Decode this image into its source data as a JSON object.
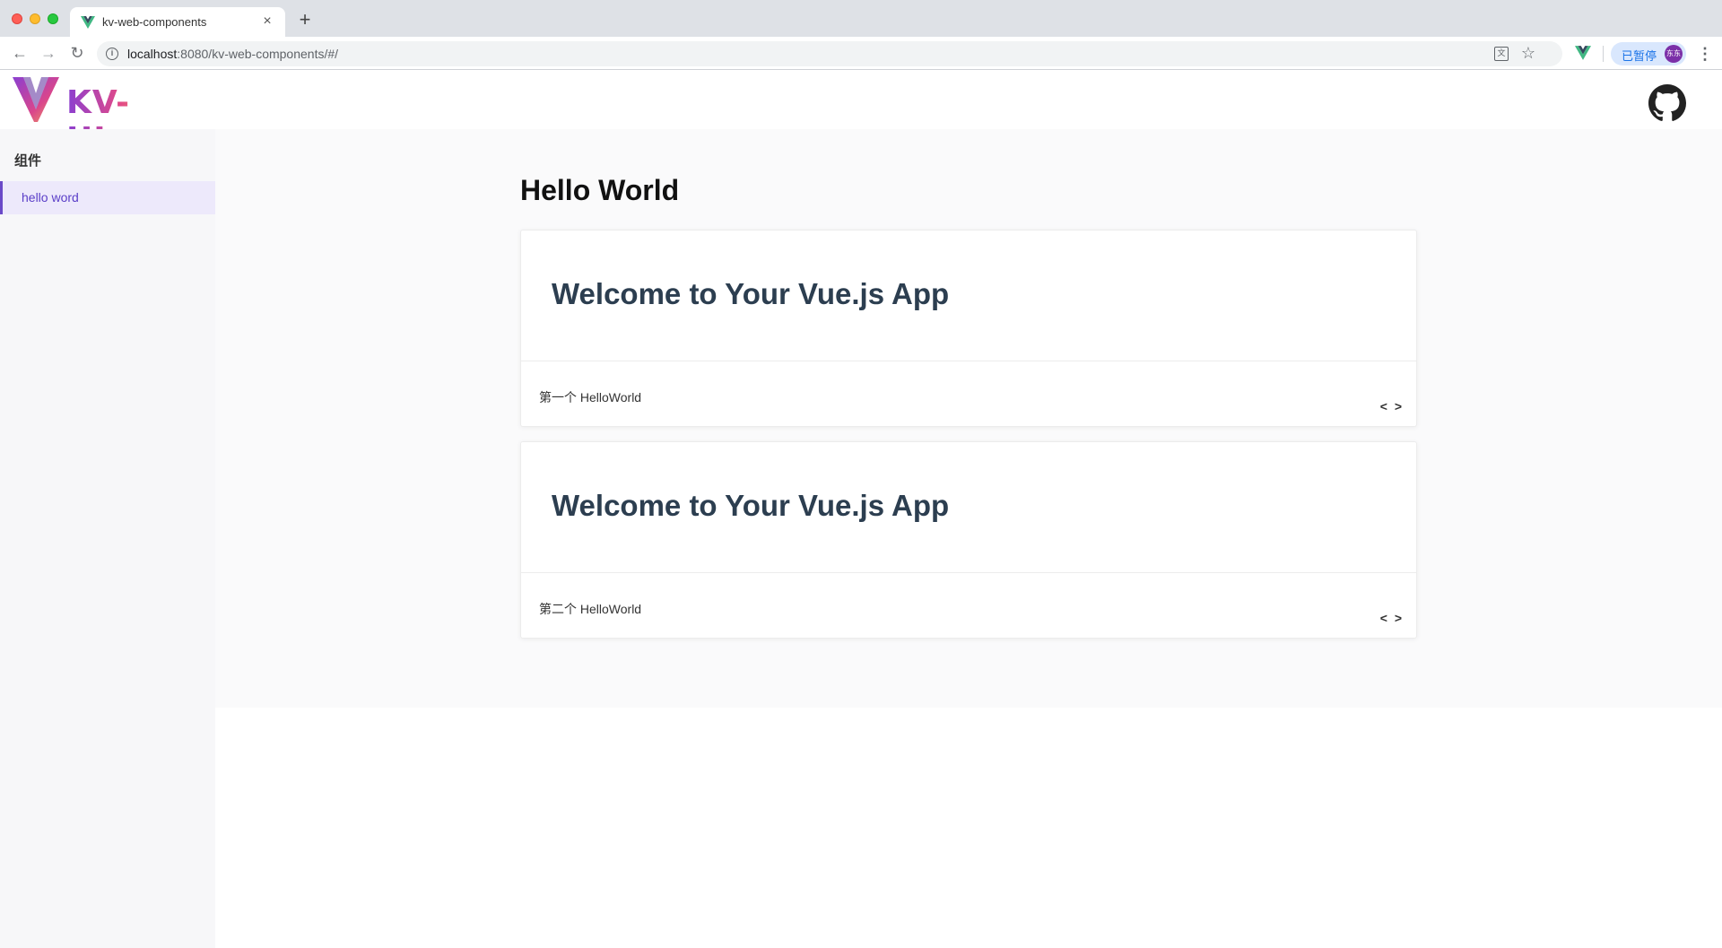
{
  "browser": {
    "tab_title": "kv-web-components",
    "tab_close": "×",
    "new_tab": "+",
    "url_host": "localhost",
    "url_rest": ":8080/kv-web-components/#/",
    "paused_label": "已暂停",
    "profile_initials": "东东"
  },
  "header": {
    "logo_text": "KV-UI",
    "logo_colors": [
      "#8a3fd1",
      "#e24a87",
      "#f2a55a"
    ]
  },
  "sidebar": {
    "heading": "组件",
    "items": [
      {
        "label": "hello word"
      }
    ]
  },
  "main": {
    "title": "Hello World",
    "demos": [
      {
        "heading": "Welcome to Your Vue.js App",
        "description": "第一个 HelloWorld",
        "code_toggle": "< >"
      },
      {
        "heading": "Welcome to Your Vue.js App",
        "description": "第二个 HelloWorld",
        "code_toggle": "< >"
      }
    ]
  },
  "colors": {
    "accent": "#6a49c8",
    "active_item_bg": "#ede9fb",
    "sidebar_bg": "#f7f7f9",
    "main_bg": "#fafafb"
  },
  "icons": [
    "vue-favicon-icon",
    "close-icon",
    "back-icon",
    "forward-icon",
    "reload-icon",
    "info-icon",
    "translate-icon",
    "star-icon",
    "vue-devtools-icon",
    "more-icon",
    "github-icon",
    "code-icon"
  ]
}
